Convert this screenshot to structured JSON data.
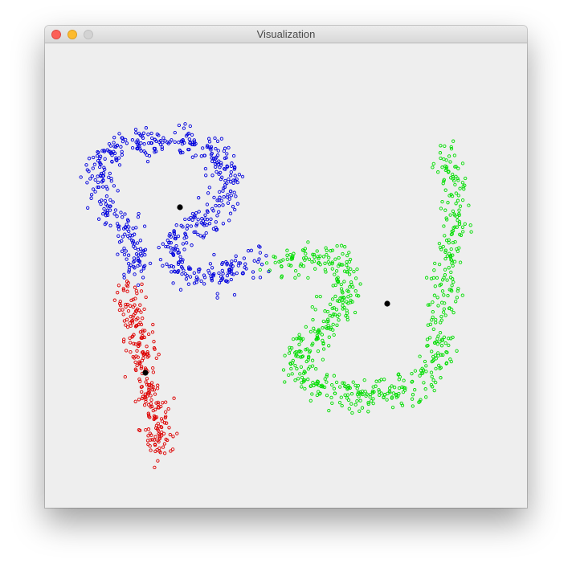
{
  "window": {
    "title": "Visualization"
  },
  "colors": {
    "cluster_red": "#dd0000",
    "cluster_blue": "#0000dd",
    "cluster_green": "#00dd00",
    "centroid": "#000000",
    "background": "#eeeeee"
  },
  "chart_data": {
    "type": "scatter",
    "title": "",
    "xlabel": "",
    "ylabel": "",
    "xlim": [
      0,
      600
    ],
    "ylim": [
      578,
      0
    ],
    "grid": false,
    "legend": "none",
    "marker": "hollow-circle",
    "series": [
      {
        "color": "#0000dd",
        "count": 600,
        "centroid": [
          168,
          204
        ],
        "shape_path": [
          [
            270,
            268
          ],
          [
            235,
            281
          ],
          [
            205,
            290
          ],
          [
            170,
            285
          ],
          [
            158,
            272
          ],
          [
            160,
            250
          ],
          [
            175,
            230
          ],
          [
            205,
            218
          ],
          [
            225,
            200
          ],
          [
            228,
            170
          ],
          [
            220,
            145
          ],
          [
            195,
            130
          ],
          [
            165,
            125
          ],
          [
            135,
            123
          ],
          [
            100,
            125
          ],
          [
            75,
            140
          ],
          [
            65,
            165
          ],
          [
            72,
            190
          ],
          [
            90,
            215
          ],
          [
            108,
            240
          ],
          [
            115,
            270
          ],
          [
            110,
            292
          ]
        ],
        "spread": 10
      },
      {
        "color": "#dd0000",
        "count": 250,
        "centroid": [
          125,
          410
        ],
        "shape_path": [
          [
            100,
            300
          ],
          [
            110,
            330
          ],
          [
            115,
            360
          ],
          [
            120,
            390
          ],
          [
            125,
            420
          ],
          [
            135,
            455
          ],
          [
            142,
            490
          ],
          [
            140,
            518
          ]
        ],
        "spread": 9
      },
      {
        "color": "#00dd00",
        "count": 650,
        "centroid": [
          426,
          324
        ],
        "shape_path": [
          [
            290,
            278
          ],
          [
            330,
            265
          ],
          [
            370,
            275
          ],
          [
            378,
            300
          ],
          [
            365,
            330
          ],
          [
            345,
            360
          ],
          [
            320,
            380
          ],
          [
            310,
            400
          ],
          [
            330,
            420
          ],
          [
            365,
            435
          ],
          [
            410,
            438
          ],
          [
            450,
            428
          ],
          [
            480,
            412
          ],
          [
            490,
            385
          ],
          [
            495,
            350
          ],
          [
            500,
            300
          ],
          [
            505,
            260
          ],
          [
            510,
            220
          ],
          [
            508,
            180
          ],
          [
            505,
            150
          ],
          [
            498,
            130
          ]
        ],
        "spread": 10
      }
    ]
  }
}
